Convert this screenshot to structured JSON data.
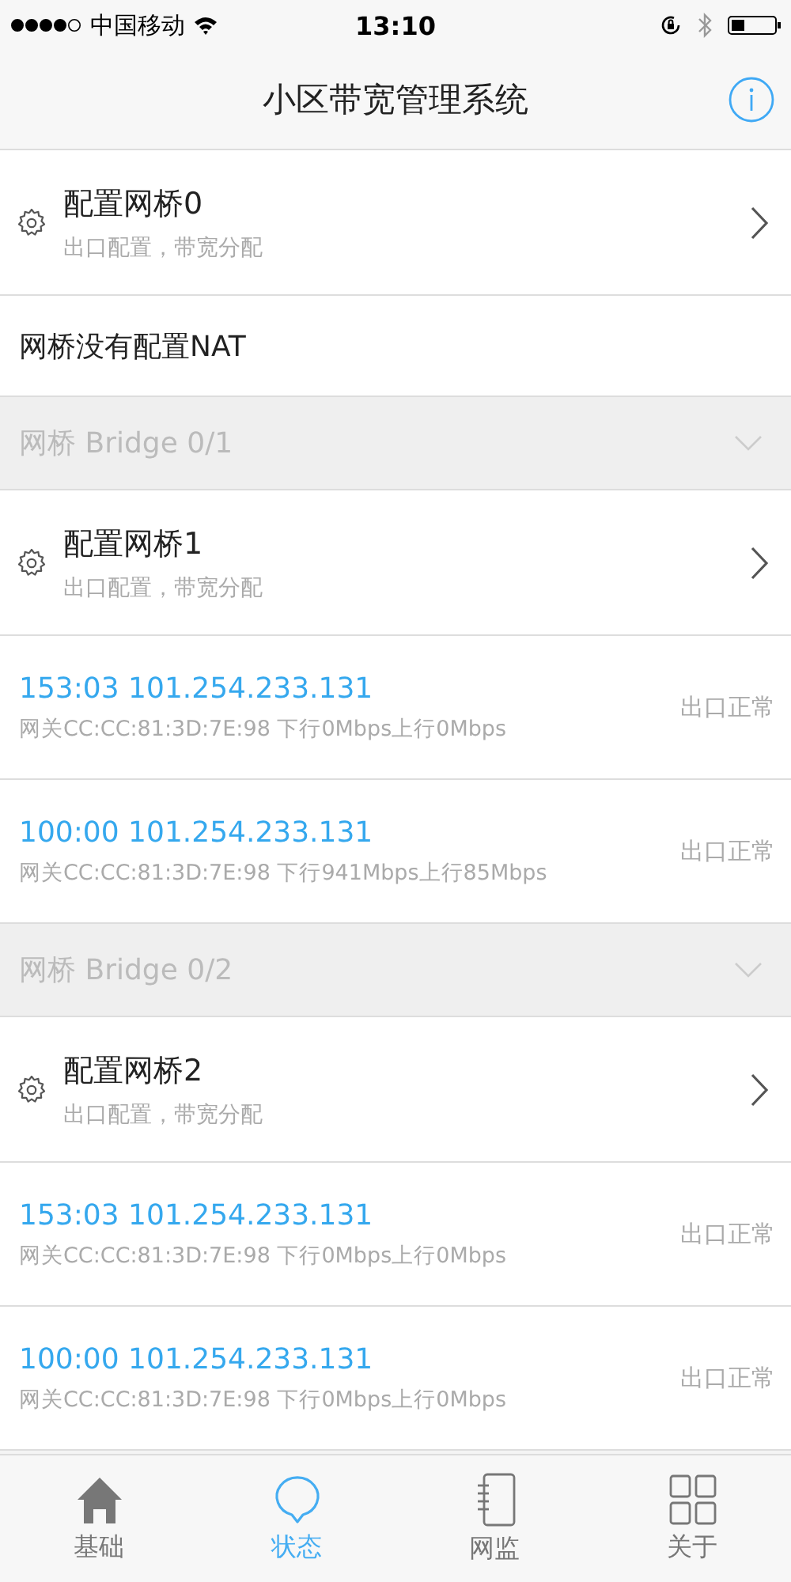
{
  "status_bar": {
    "carrier": "中国移动",
    "time": "13:10"
  },
  "nav": {
    "title": "小区带宽管理系统"
  },
  "list": [
    {
      "kind": "config",
      "title": "配置网桥0",
      "subtitle": "出口配置，带宽分配"
    },
    {
      "kind": "note",
      "text": "网桥没有配置NAT"
    },
    {
      "kind": "section",
      "title": "网桥 Bridge 0/1"
    },
    {
      "kind": "config",
      "title": "配置网桥1",
      "subtitle": "出口配置，带宽分配"
    },
    {
      "kind": "host",
      "title": "153:03 101.254.233.131",
      "detail": "网关CC:CC:81:3D:7E:98 下行0Mbps上行0Mbps",
      "status": "出口正常"
    },
    {
      "kind": "host",
      "title": "100:00 101.254.233.131",
      "detail": "网关CC:CC:81:3D:7E:98 下行941Mbps上行85Mbps",
      "status": "出口正常"
    },
    {
      "kind": "section",
      "title": "网桥 Bridge 0/2"
    },
    {
      "kind": "config",
      "title": "配置网桥2",
      "subtitle": "出口配置，带宽分配"
    },
    {
      "kind": "host",
      "title": "153:03 101.254.233.131",
      "detail": "网关CC:CC:81:3D:7E:98 下行0Mbps上行0Mbps",
      "status": "出口正常"
    },
    {
      "kind": "host",
      "title": "100:00 101.254.233.131",
      "detail": "网关CC:CC:81:3D:7E:98 下行0Mbps上行0Mbps",
      "status": "出口正常"
    }
  ],
  "tabs": [
    {
      "label": "基础",
      "selected": false
    },
    {
      "label": "状态",
      "selected": true
    },
    {
      "label": "网监",
      "selected": false
    },
    {
      "label": "关于",
      "selected": false
    }
  ]
}
